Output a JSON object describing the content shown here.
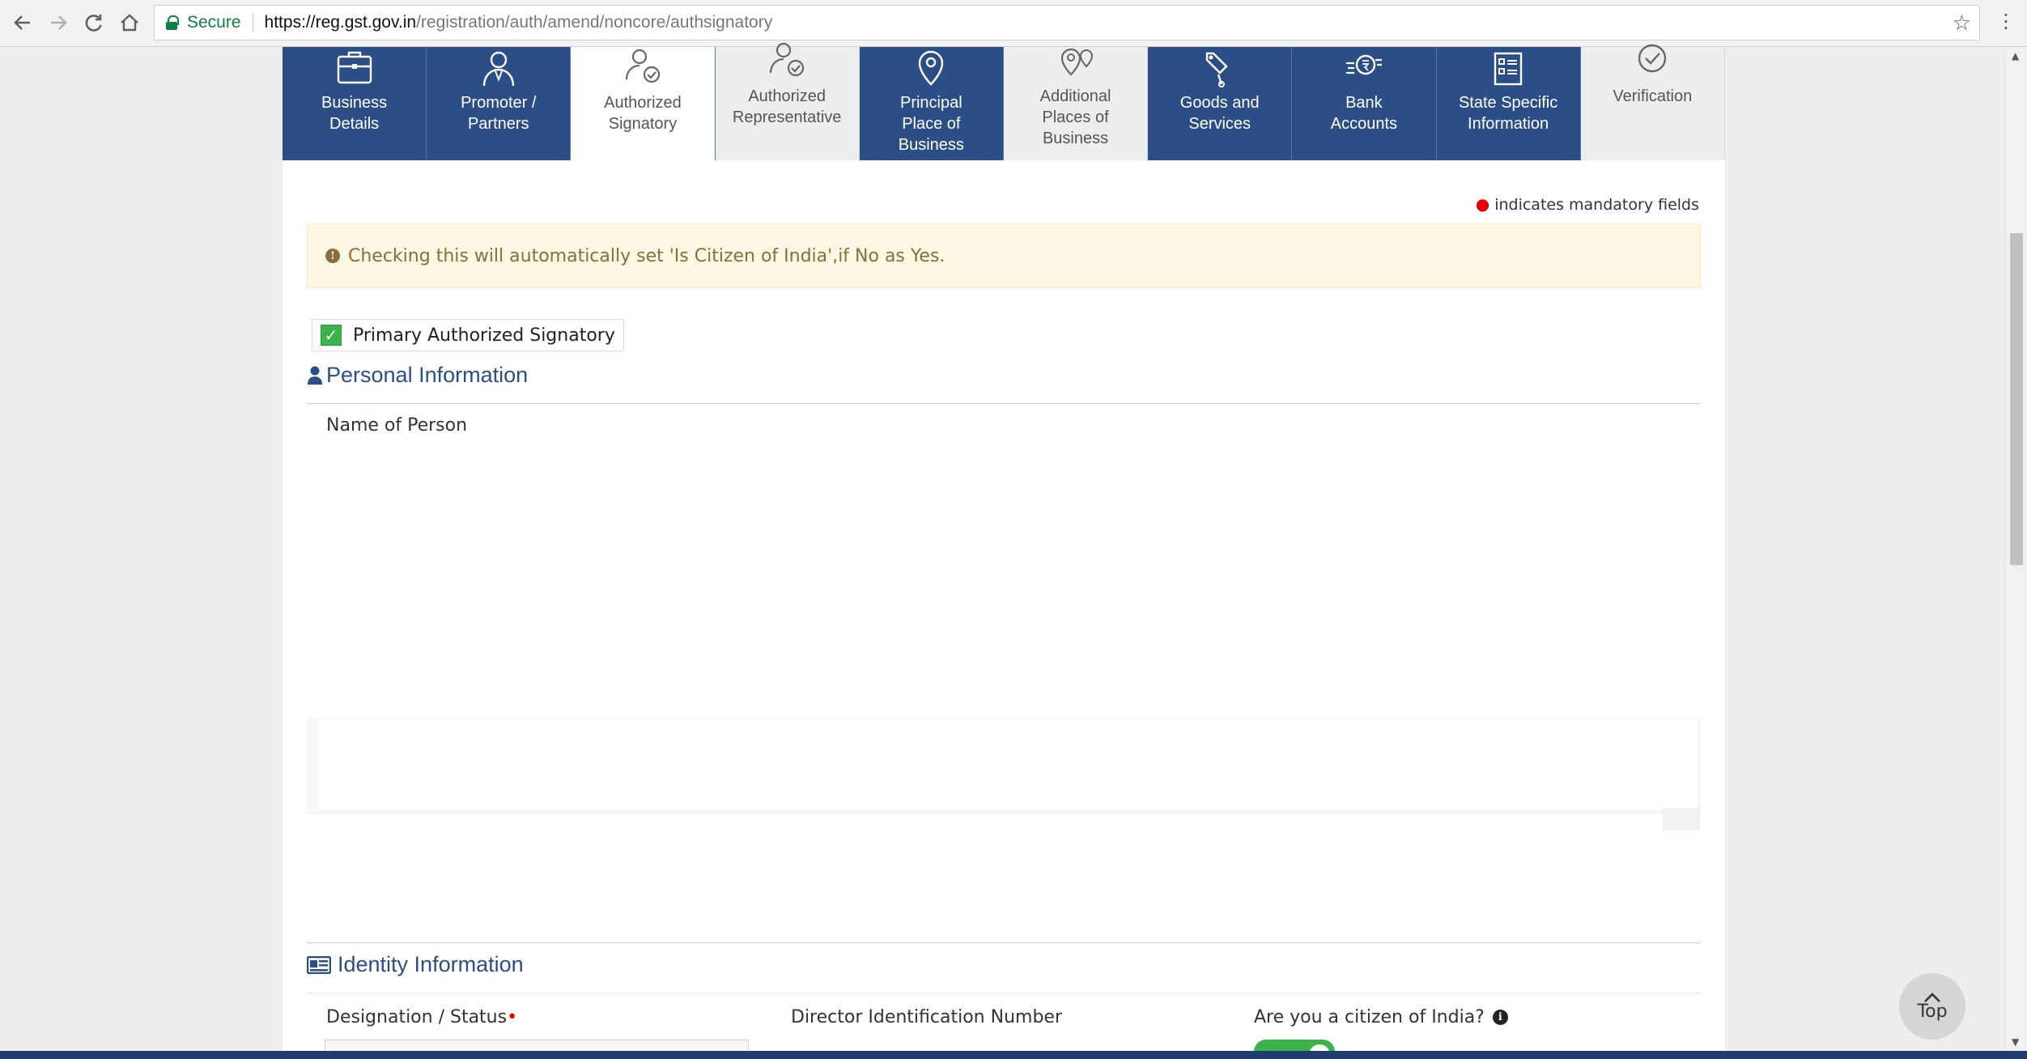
{
  "browser": {
    "secure_label": "Secure",
    "url_host": "https://reg.gst.gov.in",
    "url_path": "/registration/auth/amend/noncore/authsignatory"
  },
  "tabs": [
    {
      "line1": "Business",
      "line2": "Details",
      "line3": "",
      "style": "dark",
      "icon": "briefcase-icon"
    },
    {
      "line1": "Promoter /",
      "line2": "Partners",
      "line3": "",
      "style": "dark",
      "icon": "person-icon"
    },
    {
      "line1": "Authorized",
      "line2": "Signatory",
      "line3": "",
      "style": "active",
      "icon": "person-check-icon"
    },
    {
      "line1": "Authorized",
      "line2": "Representative",
      "line3": "",
      "style": "light",
      "icon": "person-check-icon"
    },
    {
      "line1": "Principal",
      "line2": "Place of",
      "line3": "Business",
      "style": "dark",
      "icon": "map-pin-icon"
    },
    {
      "line1": "Additional",
      "line2": "Places of",
      "line3": "Business",
      "style": "light",
      "icon": "map-pins-icon"
    },
    {
      "line1": "Goods and",
      "line2": "Services",
      "line3": "",
      "style": "dark",
      "icon": "tag-icon"
    },
    {
      "line1": "Bank",
      "line2": "Accounts",
      "line3": "",
      "style": "dark",
      "icon": "rupee-icon"
    },
    {
      "line1": "State Specific",
      "line2": "Information",
      "line3": "",
      "style": "dark",
      "icon": "form-icon"
    },
    {
      "line1": "Verification",
      "line2": "",
      "line3": "",
      "style": "light",
      "icon": "check-circle-icon"
    }
  ],
  "mandatory_note": "indicates mandatory fields",
  "alert_text": "Checking this will automatically set 'Is Citizen of India',if No as Yes.",
  "primary_signatory_label": "Primary Authorized Signatory",
  "primary_signatory_checked": true,
  "personal_info": {
    "title": "Personal Information",
    "name_label": "Name of Person"
  },
  "identity_info": {
    "title": "Identity Information",
    "designation_label": "Designation / Status",
    "din_label": "Director Identification Number",
    "citizen_label": "Are you a citizen of India?",
    "citizen_toggle": true
  },
  "top_button_label": "Top",
  "colors": {
    "tab_dark": "#2c4e86",
    "accent_green": "#3bb34a",
    "required_red": "#e40000",
    "alert_bg": "#fcf8e3",
    "alert_text": "#8a6d3b"
  }
}
